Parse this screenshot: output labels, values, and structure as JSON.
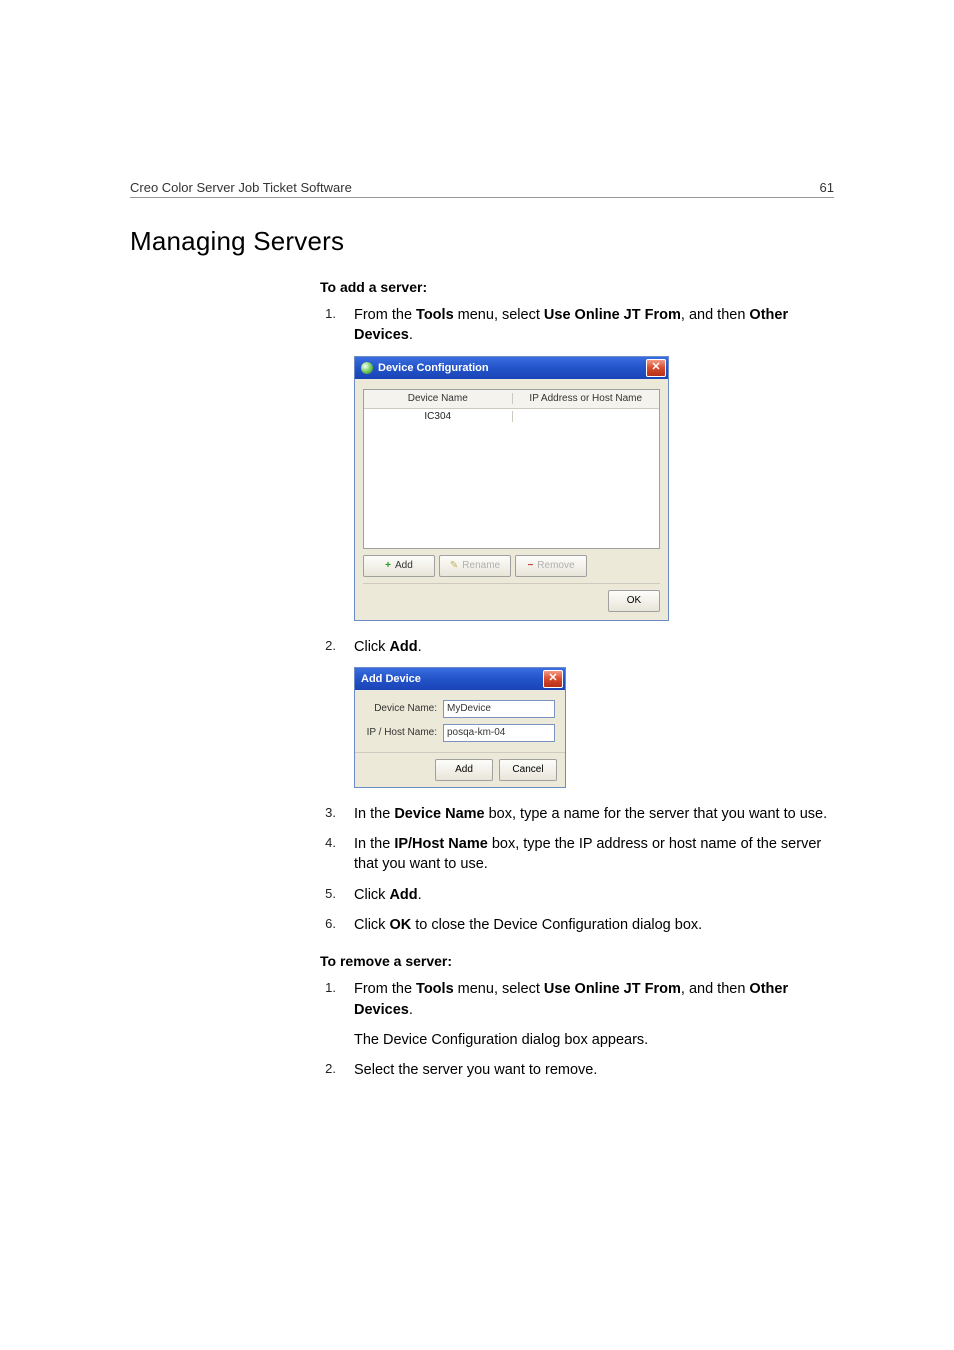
{
  "header": {
    "title": "Creo Color Server Job Ticket Software",
    "page": "61"
  },
  "h1": "Managing Servers",
  "sectionA": {
    "subhead": "To add a server:",
    "steps": [
      {
        "n": "1.",
        "pre": "From the ",
        "b1": "Tools",
        "mid1": " menu, select ",
        "b2": "Use Online JT From",
        "mid2": ", and then ",
        "b3": "Other Devices",
        "post": "."
      },
      {
        "n": "2.",
        "pre": "Click ",
        "b1": "Add",
        "post": "."
      },
      {
        "n": "3.",
        "pre": "In the ",
        "b1": "Device Name",
        "post": " box, type a name for the server that you want to use."
      },
      {
        "n": "4.",
        "pre": "In the ",
        "b1": "IP/Host Name",
        "post": " box, type the IP address or host name of the server that you want to use."
      },
      {
        "n": "5.",
        "pre": "Click ",
        "b1": "Add",
        "post": "."
      },
      {
        "n": "6.",
        "pre": "Click ",
        "b1": "OK",
        "post": " to close the Device Configuration dialog box."
      }
    ]
  },
  "sectionB": {
    "subhead": "To remove a server:",
    "steps": [
      {
        "n": "1.",
        "pre": "From the ",
        "b1": "Tools",
        "mid1": " menu, select ",
        "b2": "Use Online JT From",
        "mid2": ", and then ",
        "b3": "Other Devices",
        "post": "."
      },
      {
        "n": "2.",
        "pre": "Select the server you want to remove."
      }
    ],
    "followup": "The Device Configuration dialog box appears."
  },
  "dlg1": {
    "title": "Device Configuration",
    "cols": {
      "c1": "Device Name",
      "c2": "IP Address or Host Name"
    },
    "row1": {
      "c1": "IC304",
      "c2": ""
    },
    "btn_add": "Add",
    "btn_rename": "Rename",
    "btn_remove": "Remove",
    "btn_ok": "OK"
  },
  "dlg2": {
    "title": "Add Device",
    "lab1": "Device Name:",
    "val1": "MyDevice",
    "lab2": "IP / Host Name:",
    "val2": "posqa-km-04",
    "btn_add": "Add",
    "btn_cancel": "Cancel"
  }
}
